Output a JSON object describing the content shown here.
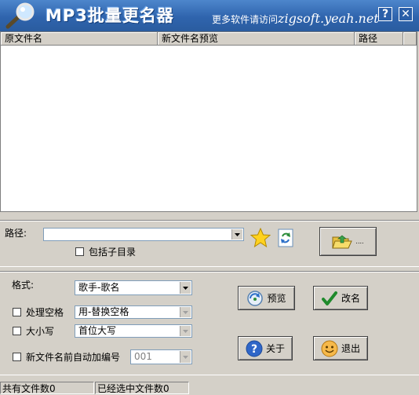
{
  "title": {
    "app_name": "MP3批量更名器",
    "visit_label": "更多软件请访问",
    "visit_url": "zigsoft.yeah.net",
    "help_glyph": "?",
    "close_glyph": "✕"
  },
  "list": {
    "columns": [
      "原文件名",
      "新文件名预览",
      "路径"
    ]
  },
  "path_panel": {
    "path_label": "路径:",
    "path_value": "",
    "include_subdirs_label": "包括子目录",
    "include_subdirs_checked": false,
    "browse_label": "...."
  },
  "options": {
    "format_label": "格式:",
    "format_value": "歌手-歌名",
    "space_label": "处理空格",
    "space_checked": false,
    "space_value": "用-替换空格",
    "case_label": "大小写",
    "case_checked": false,
    "case_value": "首位大写",
    "autonum_label": "新文件名前自动加编号",
    "autonum_checked": false,
    "autonum_value": "001"
  },
  "buttons": {
    "preview": "预览",
    "rename": "改名",
    "about": "关于",
    "exit": "退出"
  },
  "status": {
    "total": "共有文件数0",
    "selected": "已经选中文件数0"
  },
  "colors": {
    "titlebar": "#2f64ad",
    "window_bg": "#d4d0c8"
  }
}
